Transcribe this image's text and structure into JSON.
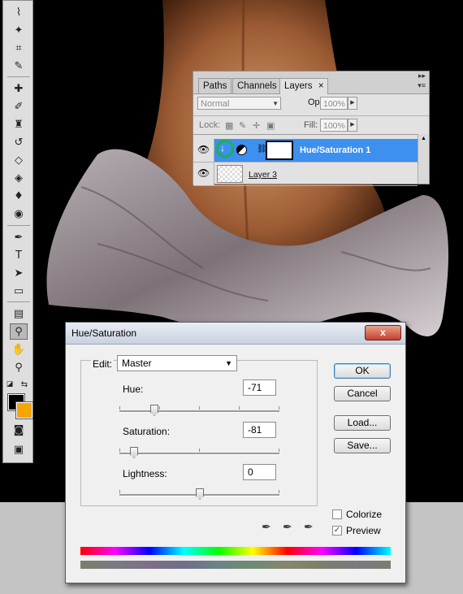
{
  "layers_panel": {
    "tabs": [
      "Paths",
      "Channels",
      "Layers"
    ],
    "active_tab": "Layers",
    "tab_close_glyph": "×",
    "blend_mode": "Normal",
    "opacity_label": "Opacity:",
    "opacity_value": "100%",
    "lock_label": "Lock:",
    "fill_label": "Fill:",
    "fill_value": "100%",
    "layers": [
      {
        "name": "Hue/Saturation 1",
        "selected": true,
        "type": "adjustment"
      },
      {
        "name": "Layer 3",
        "selected": false,
        "type": "pixel"
      }
    ]
  },
  "huesat_dialog": {
    "title": "Hue/Saturation",
    "close_glyph": "x",
    "edit_label": "Edit:",
    "edit_value": "Master",
    "hue_label": "Hue:",
    "hue_value": "-71",
    "saturation_label": "Saturation:",
    "saturation_value": "-81",
    "lightness_label": "Lightness:",
    "lightness_value": "0",
    "ok_label": "OK",
    "cancel_label": "Cancel",
    "load_label": "Load...",
    "save_label": "Save...",
    "colorize_label": "Colorize",
    "colorize_checked": false,
    "preview_label": "Preview",
    "preview_checked": true
  },
  "toolbox": {
    "tools": [
      "lasso-icon",
      "magic-wand-icon",
      "crop-icon",
      "slice-icon",
      "healing-brush-icon",
      "brush-icon",
      "clone-stamp-icon",
      "history-brush-icon",
      "eraser-icon",
      "paint-bucket-icon",
      "blur-icon",
      "dodge-icon",
      "pen-icon",
      "type-icon",
      "path-selection-icon",
      "shape-icon",
      "notes-icon",
      "eyedropper-icon",
      "hand-icon",
      "zoom-icon"
    ],
    "active_tool": "eyedropper-icon",
    "foreground_color": "#000000",
    "background_color": "#f7a500"
  },
  "colors": {
    "selection": "#3d8ff0",
    "highlight_ring": "#1fb14d"
  }
}
